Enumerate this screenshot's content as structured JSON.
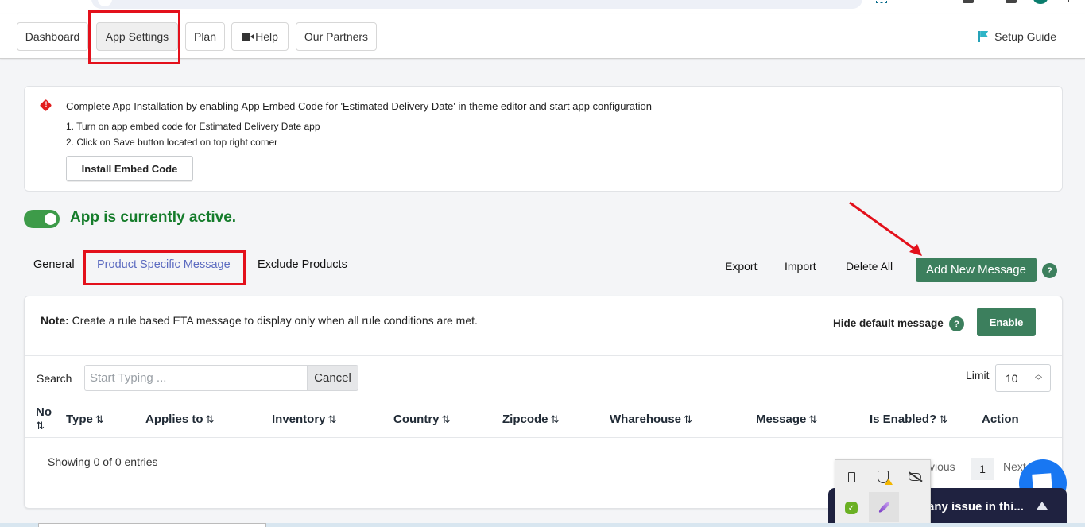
{
  "nav": {
    "buttons": [
      {
        "label": "Dashboard",
        "active": false
      },
      {
        "label": "App Settings",
        "active": true
      },
      {
        "label": "Plan",
        "active": false
      },
      {
        "label": "Help",
        "active": false,
        "icon": "video-camera-icon"
      },
      {
        "label": "Our Partners",
        "active": false
      }
    ],
    "setup_guide": {
      "label": "Setup Guide",
      "icon": "flag-icon",
      "color": "#2fb5c7"
    }
  },
  "alert": {
    "icon": "warning-diamond-icon",
    "title": "Complete App Installation by enabling App Embed Code for 'Estimated Delivery Date' in theme editor and start app configuration",
    "steps": [
      "1. Turn on app embed code for Estimated Delivery Date app",
      "2. Click on Save button located on top right corner"
    ],
    "install_button": "Install Embed Code"
  },
  "status": {
    "enabled": true,
    "text": "App is currently active.",
    "color": "#157c2b"
  },
  "tabs": [
    {
      "label": "General",
      "active": false
    },
    {
      "label": "Product Specific Message",
      "active": true
    },
    {
      "label": "Exclude Products",
      "active": false
    }
  ],
  "actions": {
    "export": "Export",
    "import": "Import",
    "delete_all": "Delete All",
    "add_new": "Add New Message",
    "help": "?"
  },
  "panel": {
    "note_label": "Note:",
    "note_text": " Create a rule based ETA message to display only when all rule conditions are met.",
    "hide_default_label": "Hide default message",
    "help": "?",
    "enable_button": "Enable",
    "search_label": "Search",
    "search_placeholder": "Start Typing ...",
    "search_value": "",
    "cancel_button": "Cancel",
    "limit_label": "Limit",
    "limit_value": "10",
    "columns": [
      {
        "label": "No",
        "sortable": true
      },
      {
        "label": "Type",
        "sortable": true
      },
      {
        "label": "Applies to",
        "sortable": true
      },
      {
        "label": "Inventory",
        "sortable": true
      },
      {
        "label": "Country",
        "sortable": true
      },
      {
        "label": "Zipcode",
        "sortable": true
      },
      {
        "label": "Wharehouse",
        "sortable": true
      },
      {
        "label": "Message",
        "sortable": true
      },
      {
        "label": "Is Enabled?",
        "sortable": true
      },
      {
        "label": "Action",
        "sortable": false
      }
    ],
    "sort_glyph": "⇅",
    "rows": [],
    "showing_text": "Showing 0 of 0 entries",
    "pagination": {
      "previous": "Previous",
      "visible_previous": "vious",
      "page": "1",
      "next": "Next",
      "visible_next": "Next"
    }
  },
  "support_widget": {
    "text": "any issue in thi..."
  },
  "colors": {
    "primary_green": "#3c7f5d",
    "tab_active": "#5c6bc0",
    "annotation_red": "#e3101b",
    "chat_blue": "#1877f2"
  }
}
